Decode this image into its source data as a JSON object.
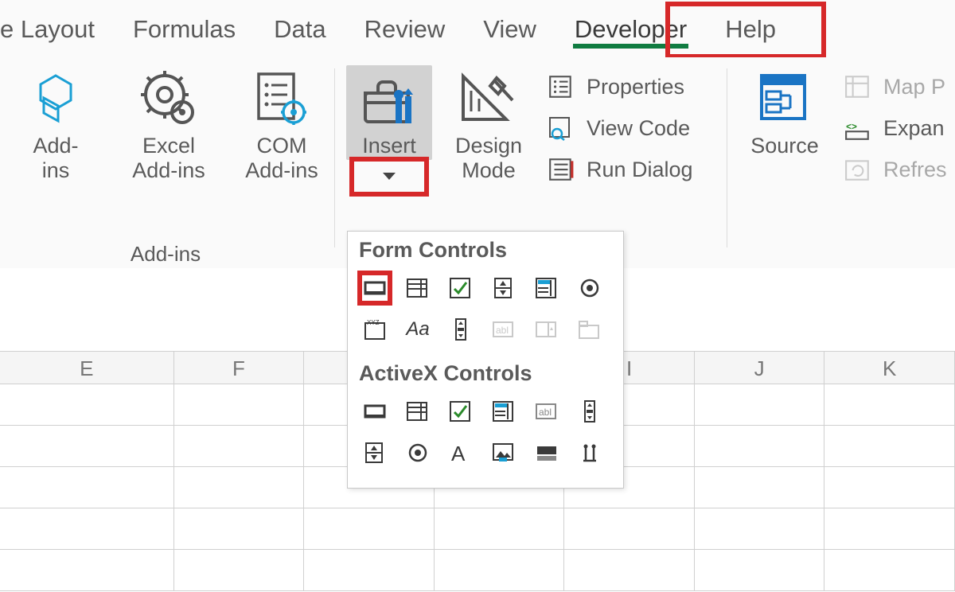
{
  "tabs": {
    "layout": "e Layout",
    "formulas": "Formulas",
    "data": "Data",
    "review": "Review",
    "view": "View",
    "developer": "Developer",
    "help": "Help"
  },
  "ribbon": {
    "addins_group_label": "Add-ins",
    "addins": {
      "label": "Add-\nins"
    },
    "excel_addins": {
      "label": "Excel\nAdd-ins"
    },
    "com_addins": {
      "label": "COM\nAdd-ins"
    },
    "insert": {
      "label": "Insert"
    },
    "design_mode": {
      "label": "Design\nMode"
    },
    "properties": {
      "label": "Properties"
    },
    "view_code": {
      "label": "View Code"
    },
    "run_dialog": {
      "label": "Run Dialog"
    },
    "source": {
      "label": "Source"
    },
    "map_p": {
      "label": "Map P"
    },
    "expan": {
      "label": "Expan"
    },
    "refres": {
      "label": "Refres"
    }
  },
  "dropdown": {
    "form_controls": "Form Controls",
    "activex_controls": "ActiveX Controls",
    "aa": "Aa"
  },
  "columns": [
    "E",
    "F",
    "",
    "",
    "I",
    "J",
    "K"
  ]
}
